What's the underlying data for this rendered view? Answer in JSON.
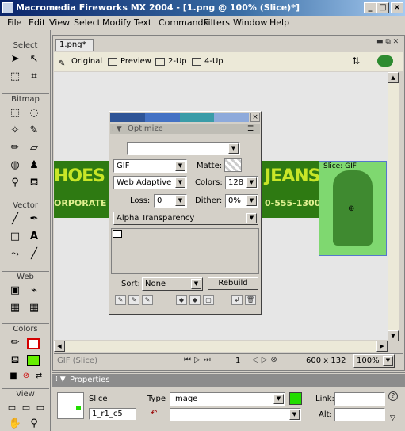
{
  "window": {
    "title": "Macromedia Fireworks MX 2004 - [1.png @ 100% (Slice)*]",
    "controls": [
      "_",
      "□",
      "×"
    ]
  },
  "menu": [
    "File",
    "Edit",
    "View",
    "Select",
    "Modify",
    "Text",
    "Commands",
    "Filters",
    "Window",
    "Help"
  ],
  "tools": {
    "sections": [
      "Select",
      "Bitmap",
      "Vector",
      "Web",
      "Colors",
      "View"
    ],
    "stroke_color": "#d40000",
    "fill_color": "#66ee00"
  },
  "document": {
    "tab": "1.png*",
    "view_tabs": [
      "Original",
      "Preview",
      "2-Up",
      "4-Up"
    ]
  },
  "canvas": {
    "banner_left_top": "HOES",
    "banner_left_bottom": "ORPORATE",
    "banner_right_top": "JEANS",
    "banner_right_bottom": "0-555-1300",
    "slice_label": "Slice: GIF"
  },
  "optimize": {
    "header": "Optimize",
    "swatches": [
      "#2f5597",
      "#4472c4",
      "#3a9ca8",
      "#8eaadb"
    ],
    "settings_value": "",
    "format": "GIF",
    "matte_label": "Matte:",
    "palette": "Web Adaptive",
    "colors_label": "Colors:",
    "colors_value": "128",
    "loss_label": "Loss:",
    "loss_value": "0",
    "dither_label": "Dither:",
    "dither_value": "0%",
    "transparency": "Alpha Transparency",
    "sort_label": "Sort:",
    "sort_value": "None",
    "rebuild_label": "Rebuild"
  },
  "status": {
    "left": "GIF (Slice)",
    "frame": "1",
    "dimensions": "600 x 132",
    "zoom": "100%"
  },
  "properties": {
    "header": "Properties",
    "slice_label": "Slice",
    "slice_name": "1_r1_c5",
    "type_label": "Type",
    "type_value": "Image",
    "link_label": "Link:",
    "alt_label": "Alt:",
    "slice_color": "#22dd00"
  }
}
